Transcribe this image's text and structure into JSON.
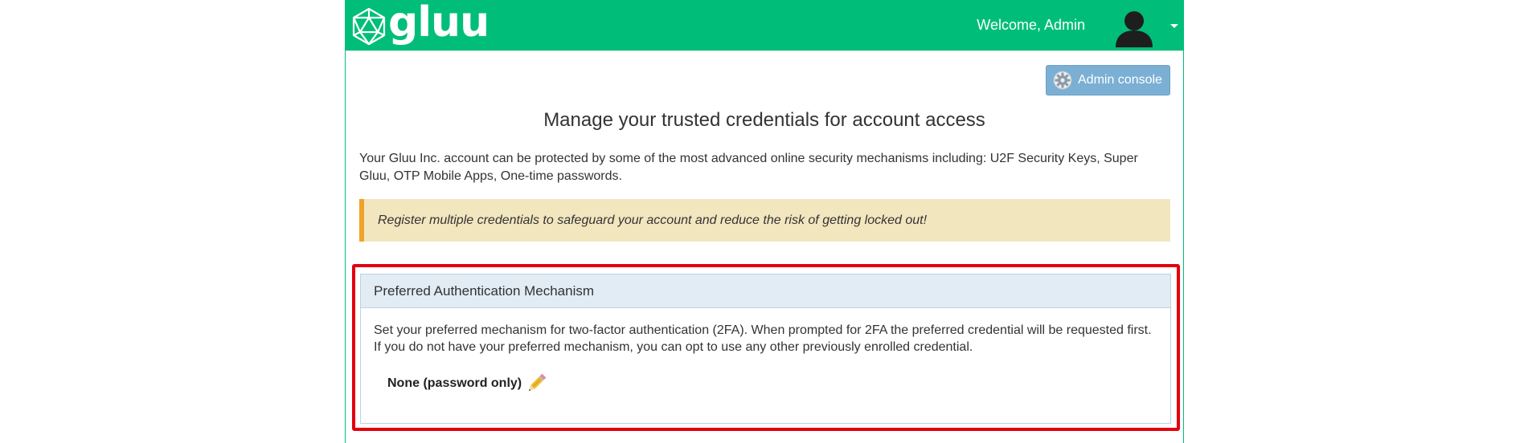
{
  "header": {
    "brand": "gluu",
    "welcome": "Welcome, Admin",
    "avatar_icon": "user-silhouette-icon",
    "menu_icon": "caret-down-icon",
    "color": "#00be79"
  },
  "toolbar": {
    "admin_console_label": "Admin console",
    "admin_console_icon": "gear-icon"
  },
  "main": {
    "title": "Manage your trusted credentials for account access",
    "intro": "Your Gluu Inc. account can be protected by some of the most advanced online security mechanisms including: U2F Security Keys, Super Gluu, OTP Mobile Apps, One-time passwords.",
    "alert": "Register multiple credentials to safeguard your account and reduce the risk of getting locked out!"
  },
  "preferred_panel": {
    "title": "Preferred Authentication Mechanism",
    "description": "Set your preferred mechanism for two-factor authentication (2FA). When prompted for 2FA the preferred credential will be requested first. If you do not have your preferred mechanism, you can opt to use any other previously enrolled credential.",
    "current_value": "None (password only)",
    "edit_icon": "pencil-icon",
    "highlight_color": "#e3000f"
  }
}
